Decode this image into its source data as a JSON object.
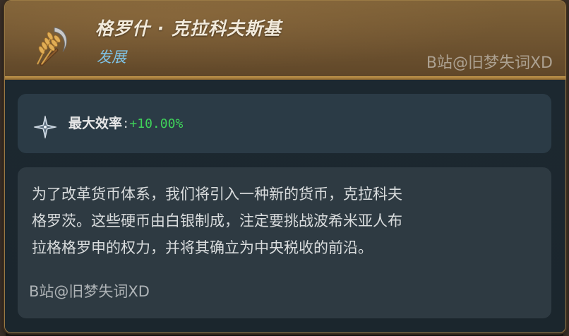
{
  "header": {
    "title": "格罗什 · 克拉科夫斯基",
    "category": "发展",
    "watermark": "B站@旧梦失词XD",
    "emblem_icon": "grain-sickle-icon"
  },
  "modifier": {
    "icon": "star-compass-icon",
    "label": "最大效率",
    "colon": ":",
    "value": "+10.00%",
    "value_color": "#3fd35a"
  },
  "description": {
    "lines": [
      "为了改革货币体系，我们将引入一种新的货币，克拉科夫",
      "格罗茨。这些硬币由白银制成，注定要挑战波希米亚人布",
      "拉格格罗申的权力，并将其确立为中央税收的前沿。"
    ],
    "watermark": "B站@旧梦失词XD"
  },
  "colors": {
    "header_bg": "#6e5330",
    "body_bg": "#1c2830",
    "panel_bg": "#2b3b46",
    "category_color": "#7fc3e6"
  }
}
